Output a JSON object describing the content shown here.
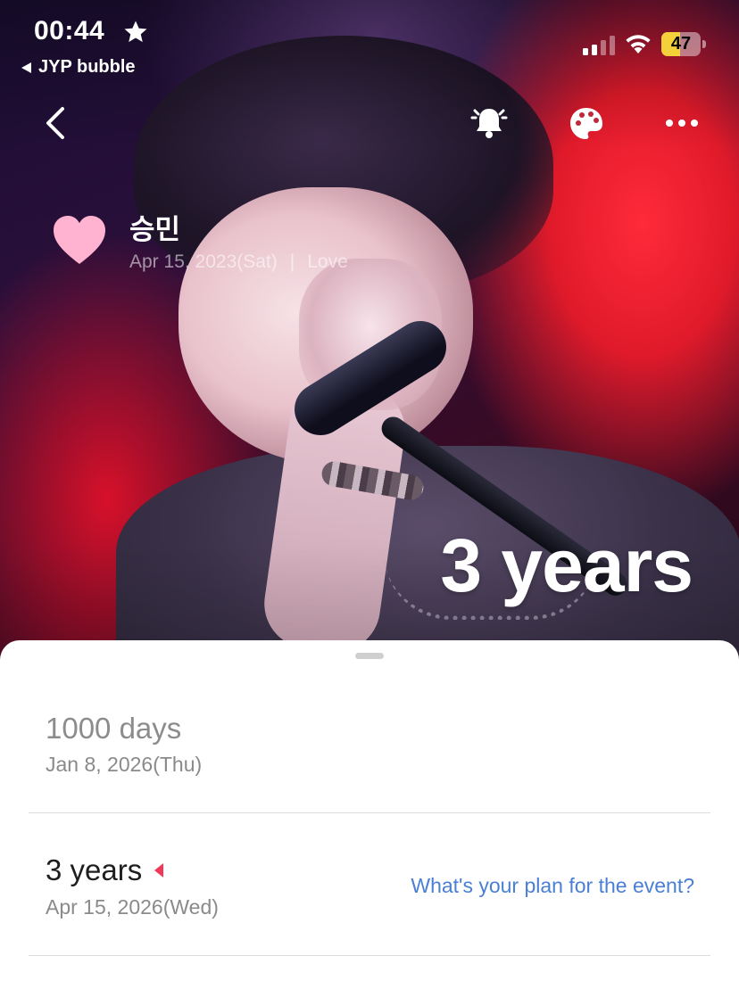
{
  "status_bar": {
    "time": "00:44",
    "back_app_label": "JYP bubble",
    "battery_percent": "47",
    "battery_level": 0.47
  },
  "toolbar": {
    "back_icon": "chevron-left-icon",
    "alarm_icon": "bell-ringing-icon",
    "theme_icon": "palette-icon",
    "more_icon": "more-horizontal-icon"
  },
  "artist": {
    "name": "승민",
    "date": "Apr 15, 2023(Sat)",
    "separator": "|",
    "relation": "Love",
    "heart_color": "#ffb3d1"
  },
  "hero": {
    "anniversary_label": "3 years"
  },
  "events": [
    {
      "title": "1000 days",
      "date": "Jan 8, 2026(Thu)"
    },
    {
      "title": "3 years",
      "date": "Apr 15, 2026(Wed)",
      "action_link": "What's your plan for the event?",
      "marker_color": "#f2385a"
    }
  ],
  "colors": {
    "link": "#4a7fd6",
    "battery": "#f4d13a"
  }
}
